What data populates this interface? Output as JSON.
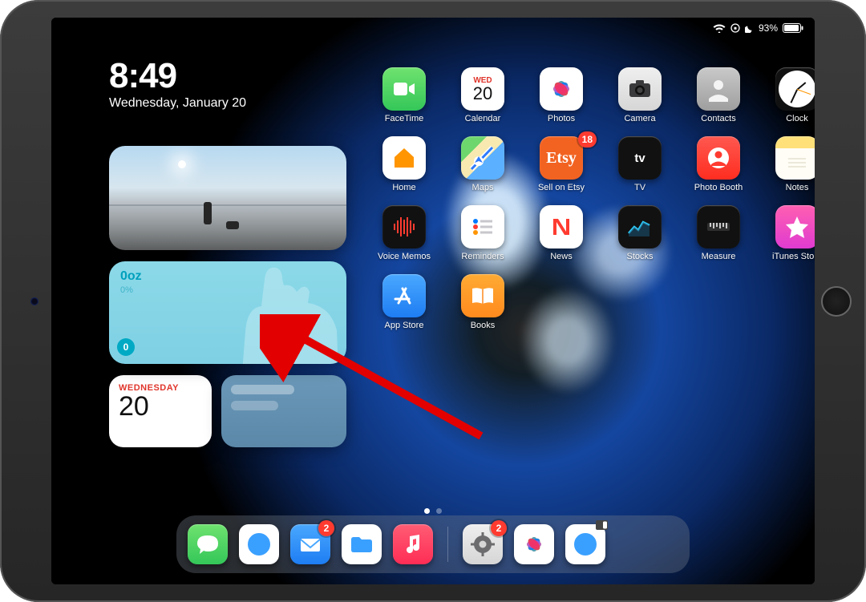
{
  "status": {
    "battery_pct": "93%"
  },
  "clock": {
    "time": "8:49",
    "date": "Wednesday, January 20"
  },
  "widgets": {
    "water": {
      "oz": "0oz",
      "pct": "0%",
      "badge": "0"
    },
    "calendar": {
      "dow": "WEDNESDAY",
      "day": "20"
    }
  },
  "apps": {
    "row1": [
      {
        "name": "FaceTime"
      },
      {
        "name": "Calendar",
        "dow": "WED",
        "day": "20"
      },
      {
        "name": "Photos"
      },
      {
        "name": "Camera"
      },
      {
        "name": "Contacts"
      },
      {
        "name": "Clock"
      }
    ],
    "row2": [
      {
        "name": "Home"
      },
      {
        "name": "Maps"
      },
      {
        "name": "Sell on Etsy",
        "badge": "18"
      },
      {
        "name": "TV"
      },
      {
        "name": "Photo Booth"
      },
      {
        "name": "Notes"
      }
    ],
    "row3": [
      {
        "name": "Voice Memos"
      },
      {
        "name": "Reminders"
      },
      {
        "name": "News"
      },
      {
        "name": "Stocks"
      },
      {
        "name": "Measure"
      },
      {
        "name": "iTunes Store"
      }
    ],
    "row4": [
      {
        "name": "App Store"
      },
      {
        "name": "Books"
      }
    ]
  },
  "dock": {
    "left": [
      {
        "name": "Messages"
      },
      {
        "name": "Safari"
      },
      {
        "name": "Mail",
        "badge": "2"
      },
      {
        "name": "Files"
      },
      {
        "name": "Music"
      }
    ],
    "right": [
      {
        "name": "Settings",
        "badge": "2"
      },
      {
        "name": "Photos"
      },
      {
        "name": "Safari"
      }
    ]
  }
}
